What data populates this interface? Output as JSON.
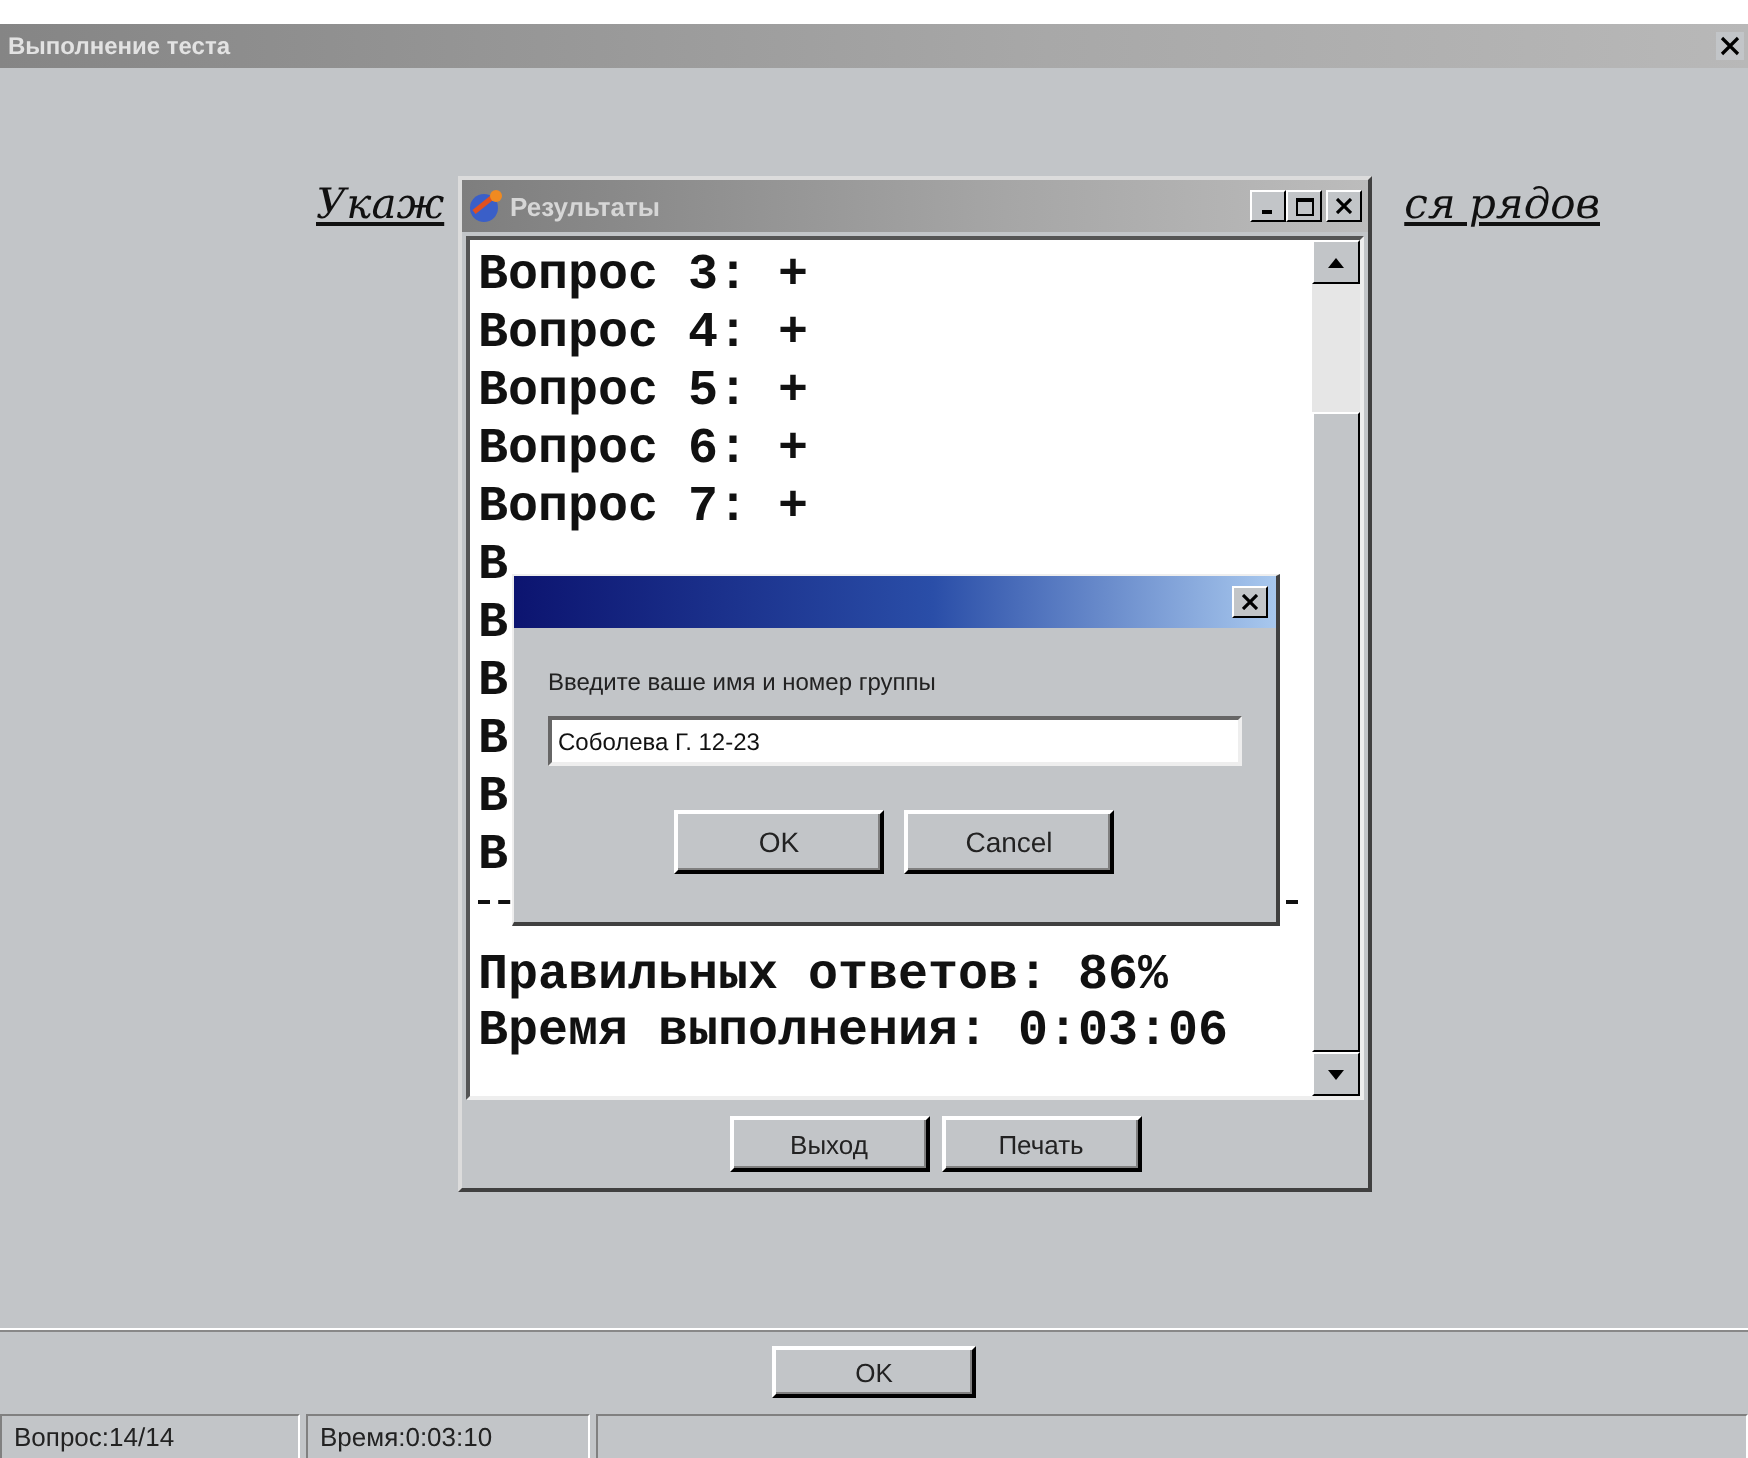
{
  "main_window": {
    "title": "Выполнение теста",
    "question_parts": [
      "Укаж",
      "ся рядов"
    ],
    "ok_button": "OK",
    "status_bar": [
      "Вопрос:14/14",
      "Время:0:03:10"
    ]
  },
  "results_window": {
    "title": "Результаты",
    "lines": [
      "Вопрос 3: +",
      "Вопрос 4: +",
      "Вопрос 5: +",
      "Вопрос 6: +",
      "Вопрос 7: +",
      "В",
      "В",
      "В",
      "В",
      "В",
      "В"
    ],
    "summary": [
      "Правильных ответов: 86%",
      "Время выполнения: 0:03:06"
    ],
    "buttons": [
      "Выход",
      "Печать"
    ]
  },
  "dialog": {
    "prompt": "Введите ваше имя и номер группы",
    "input": {
      "value": "Соболева Г. 12-23"
    },
    "buttons": [
      "OK",
      "Cancel"
    ]
  }
}
